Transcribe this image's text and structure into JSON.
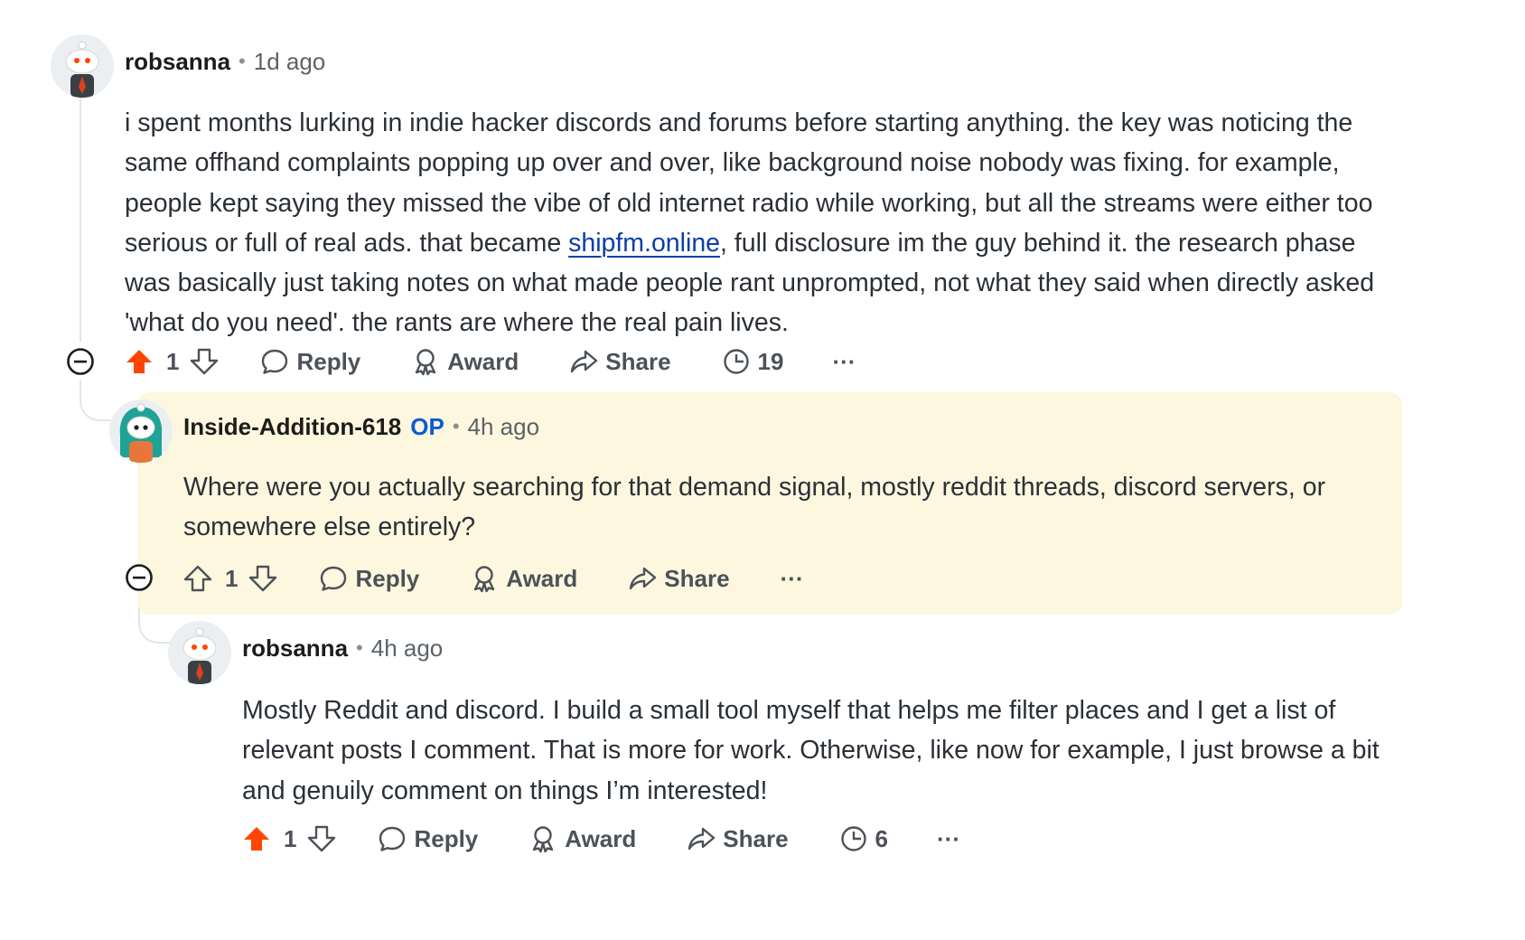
{
  "colors": {
    "upvote_active": "#ff4500",
    "op_badge": "#0a5bd6",
    "link": "#0a3fa6",
    "highlight_bg": "#fdf7df"
  },
  "comments": [
    {
      "author": "robsanna",
      "time": "1d ago",
      "avatar_icon": "snoo-avatar-suit",
      "body_before_link": "i spent months lurking in indie hacker discords and forums before starting anything. the key was noticing the same offhand complaints popping up over and over, like background noise nobody was fixing. for example, people kept saying they missed the vibe of old internet radio while working, but all the streams were either too serious or full of real ads. that became ",
      "link_text": "shipfm.online",
      "body_after_link": ", full disclosure im the guy behind it. the research phase was basically just taking notes on what made people rant unprompted, not what they said when directly asked 'what do you need'. the rants are where the real pain lives.",
      "votes": "1",
      "upvoted": true,
      "reply_label": "Reply",
      "award_label": "Award",
      "share_label": "Share",
      "views": "19",
      "more": "···"
    },
    {
      "author": "Inside-Addition-618",
      "op_label": "OP",
      "time": "4h ago",
      "avatar_icon": "snoo-avatar-teal-hair",
      "body": "Where were you actually searching for that demand signal, mostly reddit threads, discord servers, or somewhere else entirely?",
      "votes": "1",
      "upvoted": false,
      "reply_label": "Reply",
      "award_label": "Award",
      "share_label": "Share",
      "more": "···"
    },
    {
      "author": "robsanna",
      "time": "4h ago",
      "avatar_icon": "snoo-avatar-suit",
      "body": "Mostly Reddit and discord. I build a small tool myself that helps me filter places and I get a list of relevant posts I comment. That is more for work. Otherwise, like now for example, I just browse a bit and genuily comment on things I’m interested!",
      "votes": "1",
      "upvoted": true,
      "reply_label": "Reply",
      "award_label": "Award",
      "share_label": "Share",
      "views": "6",
      "more": "···"
    }
  ]
}
